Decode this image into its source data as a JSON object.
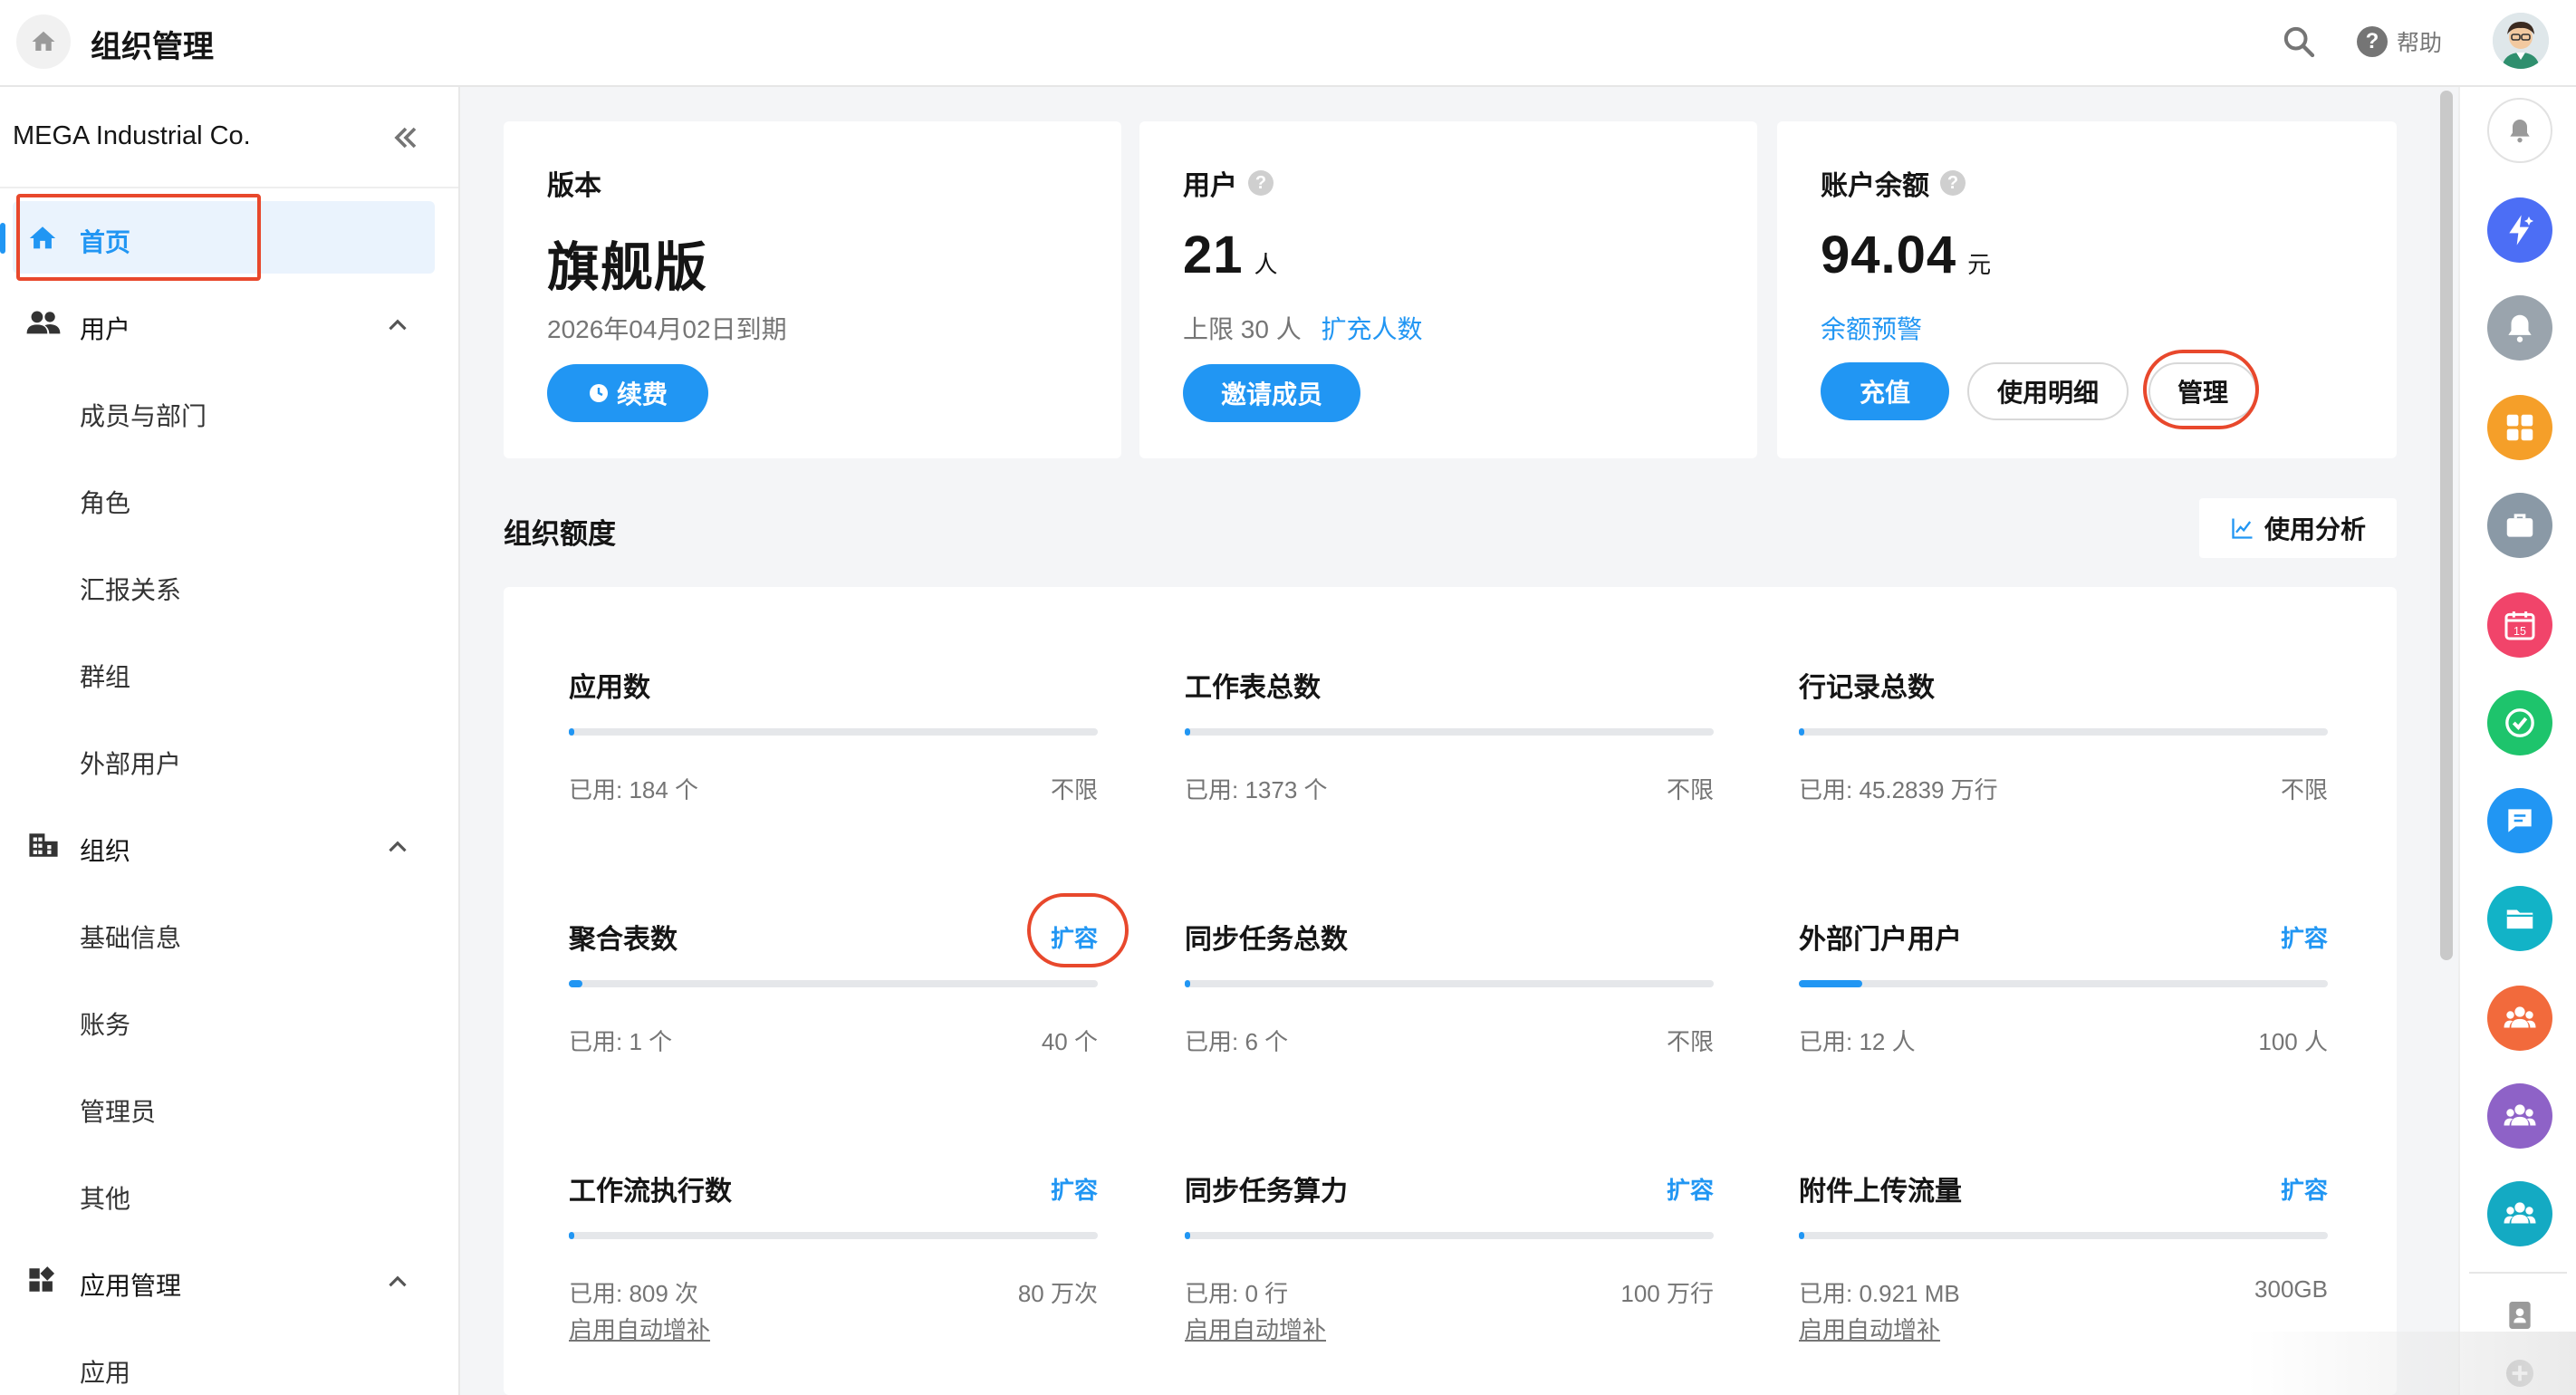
{
  "topbar": {
    "title": "组织管理",
    "help_label": "帮助",
    "help_glyph": "?"
  },
  "sidebar": {
    "org_name": "MEGA Industrial Co.",
    "home_label": "首页",
    "groups": [
      {
        "label": "用户",
        "items": [
          "成员与部门",
          "角色",
          "汇报关系",
          "群组",
          "外部用户"
        ]
      },
      {
        "label": "组织",
        "items": [
          "基础信息",
          "账务",
          "管理员",
          "其他"
        ]
      },
      {
        "label": "应用管理",
        "items": [
          "应用"
        ]
      }
    ]
  },
  "cards": {
    "edition": {
      "title": "版本",
      "value": "旗舰版",
      "expiry": "2026年04月02日到期",
      "renew_label": "续费"
    },
    "users": {
      "title": "用户",
      "count": "21",
      "unit": "人",
      "limit_text": "上限 30 人",
      "expand_link": "扩充人数",
      "invite_label": "邀请成员"
    },
    "balance": {
      "title": "账户余额",
      "amount": "94.04",
      "unit": "元",
      "warning_link": "余额预警",
      "recharge_label": "充值",
      "details_label": "使用明细",
      "manage_label": "管理"
    }
  },
  "quota_section": {
    "title": "组织额度",
    "analysis_label": "使用分析",
    "items": [
      {
        "title": "应用数",
        "used": "已用: 184 个",
        "limit": "不限",
        "expand": "",
        "auto": "",
        "fill": 0.01
      },
      {
        "title": "工作表总数",
        "used": "已用: 1373 个",
        "limit": "不限",
        "expand": "",
        "auto": "",
        "fill": 0.01
      },
      {
        "title": "行记录总数",
        "used": "已用: 45.2839 万行",
        "limit": "不限",
        "expand": "",
        "auto": "",
        "fill": 0.01
      },
      {
        "title": "聚合表数",
        "used": "已用: 1 个",
        "limit": "40 个",
        "expand": "扩容",
        "auto": "",
        "fill": 0.025
      },
      {
        "title": "同步任务总数",
        "used": "已用: 6 个",
        "limit": "不限",
        "expand": "",
        "auto": "",
        "fill": 0.01
      },
      {
        "title": "外部门户用户",
        "used": "已用: 12 人",
        "limit": "100 人",
        "expand": "扩容",
        "auto": "",
        "fill": 0.12
      },
      {
        "title": "工作流执行数",
        "used": "已用: 809 次",
        "limit": "80 万次",
        "expand": "扩容",
        "auto": "启用自动增补",
        "fill": 0.001
      },
      {
        "title": "同步任务算力",
        "used": "已用: 0 行",
        "limit": "100 万行",
        "expand": "扩容",
        "auto": "启用自动增补",
        "fill": 0.0
      },
      {
        "title": "附件上传流量",
        "used": "已用: 0.921 MB",
        "limit": "300GB",
        "expand": "扩容",
        "auto": "启用自动增补",
        "fill": 0.0
      }
    ]
  },
  "right_rail": {
    "icons": [
      "bell-outline-icon",
      "lightning-icon",
      "bell-icon",
      "grid-icon",
      "briefcase-icon",
      "calendar-icon",
      "check-icon",
      "chat-icon",
      "folder-icon",
      "group-orange-icon",
      "group-purple-icon",
      "group-teal-icon",
      "contacts-icon",
      "plus-icon"
    ],
    "calendar_day": "15",
    "colors": {
      "lightning": "#4c6ef5",
      "bell": "#9aa4ad",
      "grid": "#f59f29",
      "briefcase": "#8a99a6",
      "calendar": "#f1446a",
      "check": "#1ec46c",
      "chat": "#2196f3",
      "folder": "#12b3c7",
      "group_orange": "#f26a3c",
      "group_purple": "#8e62c7",
      "group_teal": "#14aac3"
    }
  },
  "colors": {
    "accent": "#2196f3",
    "annotation_red": "#e8482c"
  }
}
